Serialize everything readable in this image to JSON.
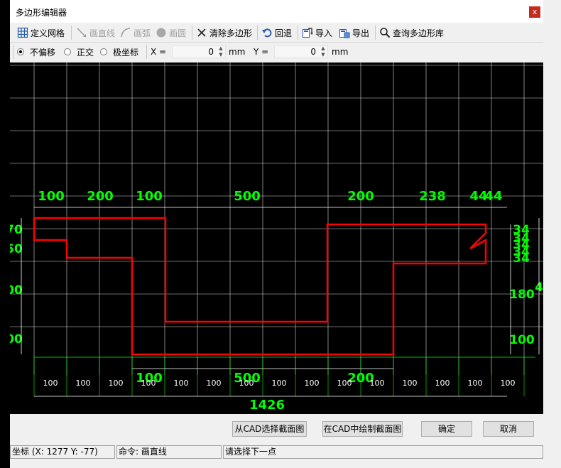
{
  "window": {
    "title": "多边形编辑器",
    "close_glyph": "x"
  },
  "toolbar": [
    {
      "key": "define_grid",
      "label": "定义网格",
      "icon": "grid-icon",
      "enabled": true
    },
    {
      "key": "draw_line",
      "label": "画直线",
      "icon": "line-icon",
      "enabled": false
    },
    {
      "key": "draw_arc",
      "label": "画弧",
      "icon": "arc-icon",
      "enabled": false
    },
    {
      "key": "draw_circle",
      "label": "画圆",
      "icon": "circle-icon",
      "enabled": false
    },
    {
      "key": "clear_polygon",
      "label": "清除多边形",
      "icon": "clear-x-icon",
      "enabled": true
    },
    {
      "key": "undo",
      "label": "回退",
      "icon": "undo-icon",
      "enabled": true
    },
    {
      "key": "import",
      "label": "导入",
      "icon": "import-icon",
      "enabled": true
    },
    {
      "key": "export",
      "label": "导出",
      "icon": "export-icon",
      "enabled": true
    },
    {
      "key": "query_library",
      "label": "查询多边形库",
      "icon": "search-icon",
      "enabled": true
    }
  ],
  "options": {
    "modes": [
      {
        "label": "不偏移",
        "selected": true
      },
      {
        "label": "正交",
        "selected": false
      },
      {
        "label": "极坐标",
        "selected": false
      }
    ],
    "x_label": "X =",
    "x_value": "0",
    "x_unit": "mm",
    "y_label": "Y =",
    "y_value": "0",
    "y_unit": "mm"
  },
  "canvas": {
    "colors": {
      "grid": "#ffffff",
      "dim": "#00ff00",
      "polygon": "#ff0000",
      "axis": "#ffffff"
    },
    "top_dims": [
      "100",
      "200",
      "100",
      "500",
      "200",
      "238",
      "44",
      "44"
    ],
    "right_dims": [
      "34",
      "34",
      "34",
      "34",
      "34"
    ],
    "right_extra": [
      "180",
      "100"
    ],
    "right_partial": "4",
    "left_dims": [
      "70",
      "50",
      "00",
      "00"
    ],
    "inner_bottom_dims": [
      "100",
      "500",
      "200"
    ],
    "grid_labels": [
      "100",
      "100",
      "100",
      "100",
      "100",
      "100",
      "100",
      "100",
      "100",
      "100",
      "100",
      "100",
      "100",
      "100",
      "100"
    ],
    "total_width": "1426"
  },
  "buttons": {
    "select_from_cad": "从CAD选择截面图",
    "draw_in_cad": "在CAD中绘制截面图",
    "ok": "确定",
    "cancel": "取消"
  },
  "status": {
    "coords": "坐标 (X: 1277 Y: -77)",
    "command": "命令: 画直线",
    "prompt": "请选择下一点"
  }
}
